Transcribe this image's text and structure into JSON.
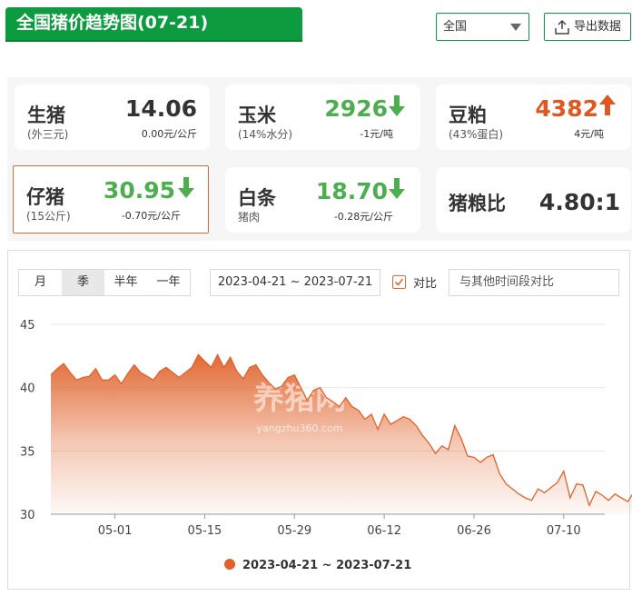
{
  "header": {
    "title": "全国猪价趋势图(07-21)"
  },
  "region": {
    "selected": "全国"
  },
  "export": {
    "label": "导出数据"
  },
  "cards": [
    {
      "name": "生猪",
      "sub": "(外三元)",
      "price": "14.06",
      "change": "0.00元/公斤",
      "trend": "flat"
    },
    {
      "name": "玉米",
      "sub": "(14%水分)",
      "price": "2926",
      "change": "-1元/吨",
      "trend": "down"
    },
    {
      "name": "豆粕",
      "sub": "(43%蛋白)",
      "price": "4382",
      "change": "4元/吨",
      "trend": "up"
    },
    {
      "name": "仔猪",
      "sub": "(15公斤)",
      "price": "30.95",
      "change": "-0.70元/公斤",
      "trend": "down"
    },
    {
      "name": "白条",
      "sub": "猪肉",
      "price": "18.70",
      "change": "-0.28元/公斤",
      "trend": "down"
    },
    {
      "name": "猪粮比",
      "price": "4.80:1"
    }
  ],
  "colors": {
    "brand_green": "#0d9b3f",
    "up_orange": "#e2561f",
    "down_green": "#4cae4f",
    "series": "#e0622a"
  },
  "controls": {
    "periods": [
      "月",
      "季",
      "半年",
      "一年"
    ],
    "active_period": "季",
    "date_range": "2023-04-21 ~ 2023-07-21",
    "compare_label": "对比",
    "compare_checked": true,
    "compare_placeholder": "与其他时间段对比"
  },
  "watermark": {
    "text": "养猪网",
    "domain": "yangzhu360.com"
  },
  "chart_data": {
    "type": "area",
    "x_ticks": [
      "05-01",
      "05-15",
      "05-29",
      "06-12",
      "06-26",
      "07-10"
    ],
    "ylim": [
      30,
      45
    ],
    "y_ticks": [
      30,
      35,
      40,
      45
    ],
    "grid": "horizontal",
    "legend": "bottom",
    "series": [
      {
        "name": "2023-04-21 ~ 2023-07-21",
        "dates": [
          "04-21",
          "04-22",
          "04-23",
          "04-24",
          "04-25",
          "04-26",
          "04-27",
          "04-28",
          "04-29",
          "04-30",
          "05-01",
          "05-02",
          "05-03",
          "05-04",
          "05-05",
          "05-06",
          "05-07",
          "05-08",
          "05-09",
          "05-10",
          "05-11",
          "05-12",
          "05-13",
          "05-14",
          "05-15",
          "05-16",
          "05-17",
          "05-18",
          "05-19",
          "05-20",
          "05-21",
          "05-22",
          "05-23",
          "05-24",
          "05-25",
          "05-26",
          "05-27",
          "05-28",
          "05-29",
          "05-30",
          "05-31",
          "06-01",
          "06-02",
          "06-03",
          "06-04",
          "06-05",
          "06-06",
          "06-07",
          "06-08",
          "06-09",
          "06-10",
          "06-11",
          "06-12",
          "06-13",
          "06-14",
          "06-15",
          "06-16",
          "06-17",
          "06-18",
          "06-19",
          "06-20",
          "06-21",
          "06-22",
          "06-23",
          "06-24",
          "06-25",
          "06-26",
          "06-27",
          "06-28",
          "06-29",
          "06-30",
          "07-01",
          "07-02",
          "07-03",
          "07-04",
          "07-05",
          "07-06",
          "07-07",
          "07-08",
          "07-09",
          "07-10",
          "07-11",
          "07-12",
          "07-13",
          "07-14",
          "07-15",
          "07-16",
          "07-17",
          "07-18",
          "07-19",
          "07-20",
          "07-21"
        ],
        "values": [
          41.0,
          41.5,
          41.9,
          41.2,
          40.6,
          40.8,
          40.9,
          41.5,
          40.6,
          40.6,
          41.0,
          40.3,
          41.1,
          41.8,
          41.2,
          40.9,
          40.6,
          41.3,
          41.6,
          41.2,
          40.8,
          41.2,
          41.6,
          42.6,
          42.1,
          41.6,
          42.6,
          41.6,
          42.4,
          41.3,
          40.7,
          41.6,
          41.8,
          41.0,
          40.4,
          39.9,
          40.1,
          40.8,
          41.0,
          40.0,
          39.0,
          39.8,
          40.0,
          39.2,
          38.9,
          38.5,
          39.2,
          38.5,
          38.2,
          37.5,
          37.9,
          36.7,
          37.9,
          37.1,
          37.4,
          37.7,
          37.5,
          37.0,
          36.2,
          35.6,
          34.8,
          35.4,
          35.1,
          37.0,
          36.0,
          34.6,
          34.5,
          34.1,
          34.5,
          34.7,
          33.2,
          32.4,
          32.0,
          31.6,
          31.3,
          31.1,
          32.0,
          31.7,
          32.1,
          32.5,
          33.4,
          31.3,
          32.4,
          32.3,
          30.7,
          31.8,
          31.5,
          31.1,
          31.6,
          31.3,
          31.0,
          31.8,
          31.2,
          30.9
        ]
      }
    ]
  }
}
